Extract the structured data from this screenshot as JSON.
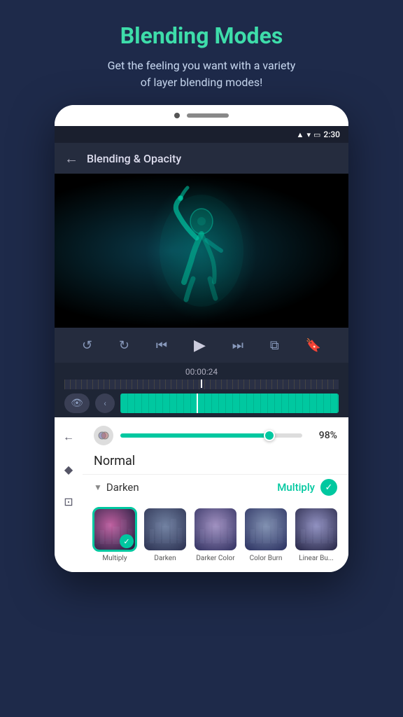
{
  "page": {
    "title": "Blending Modes",
    "subtitle": "Get the feeling you want with a variety\nof layer blending modes!",
    "accent_color": "#3eddaa"
  },
  "status_bar": {
    "time": "2:30"
  },
  "app_bar": {
    "title": "Blending & Opacity",
    "back_label": "←"
  },
  "playback": {
    "timestamp": "00:00:24",
    "undo_label": "↺",
    "redo_label": "↻",
    "skip_start_label": "⏮",
    "play_label": "▶",
    "skip_end_label": "⏭",
    "loop_label": "⧉",
    "bookmark_label": "🔖"
  },
  "opacity": {
    "value": "98%",
    "percent": 98
  },
  "blend_mode": {
    "current": "Normal",
    "category": "Darken",
    "active_item": "Multiply",
    "check_label": "✓"
  },
  "blend_options": [
    {
      "label": "Multiply",
      "active": true,
      "gradient": "radial-gradient(circle at 40% 40%, #c060a0, #1a1a3a)"
    },
    {
      "label": "Darken",
      "active": false,
      "gradient": "radial-gradient(circle at 50% 40%, #7080a0, #2a3050)"
    },
    {
      "label": "Darker Color",
      "active": false,
      "gradient": "radial-gradient(circle at 50% 40%, #a090c0, #303060)"
    },
    {
      "label": "Color Burn",
      "active": false,
      "gradient": "radial-gradient(circle at 50% 40%, #8090b0, #2a3060)"
    },
    {
      "label": "Linear Bu...",
      "active": false,
      "gradient": "radial-gradient(circle at 50% 40%, #9090c0, #252545)"
    }
  ],
  "left_sidebar": {
    "back_icon": "←",
    "diamond_icon": "◆",
    "crop_icon": "⊡"
  }
}
